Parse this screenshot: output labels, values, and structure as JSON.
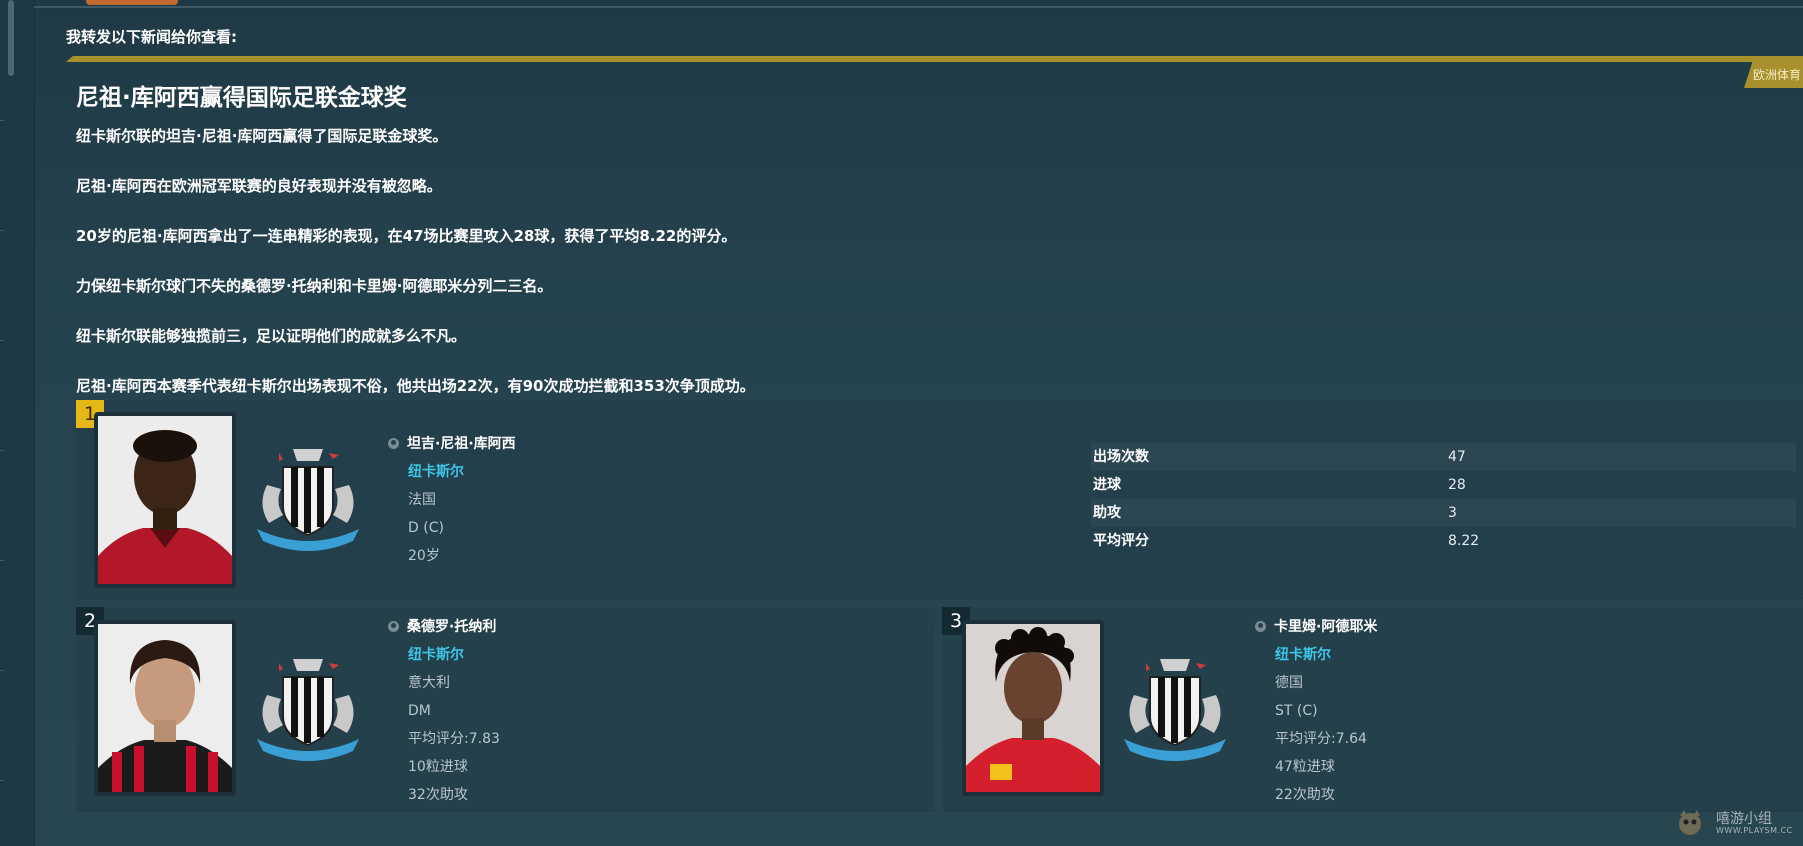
{
  "intro_text": "我转发以下新闻给你查看:",
  "source_badge": "欧洲体育",
  "news": {
    "title": "尼祖·库阿西赢得国际足联金球奖",
    "paragraphs": [
      "纽卡斯尔联的坦吉·尼祖·库阿西赢得了国际足联金球奖。",
      "尼祖·库阿西在欧洲冠军联赛的良好表现并没有被忽略。",
      "20岁的尼祖·库阿西拿出了一连串精彩的表现，在47场比赛里攻入28球，获得了平均8.22的评分。",
      "力保纽卡斯尔球门不失的桑德罗·托纳利和卡里姆·阿德耶米分列二三名。",
      "纽卡斯尔联能够独揽前三，足以证明他们的成就多么不凡。",
      "尼祖·库阿西本赛季代表纽卡斯尔出场表现不俗，他共出场22次，有90次成功拦截和353次争顶成功。"
    ]
  },
  "winner": {
    "rank": "1",
    "name": "坦吉·尼祖·库阿西",
    "club": "纽卡斯尔",
    "nationality": "法国",
    "position": "D (C)",
    "age": "20岁",
    "stats": [
      {
        "label": "出场次数",
        "value": "47"
      },
      {
        "label": "进球",
        "value": "28"
      },
      {
        "label": "助攻",
        "value": "3"
      },
      {
        "label": "平均评分",
        "value": "8.22"
      }
    ]
  },
  "runners_up": [
    {
      "rank": "2",
      "name": "桑德罗·托纳利",
      "club": "纽卡斯尔",
      "nationality": "意大利",
      "position": "DM",
      "rating": "平均评分:7.83",
      "goals": "10粒进球",
      "assists": "32次助攻"
    },
    {
      "rank": "3",
      "name": "卡里姆·阿德耶米",
      "club": "纽卡斯尔",
      "nationality": "德国",
      "position": "ST (C)",
      "rating": "平均评分:7.64",
      "goals": "47粒进球",
      "assists": "22次助攻"
    }
  ],
  "watermark": {
    "main": "嘻游小组",
    "sub": "WWW.PLAYSM.CC"
  },
  "colors": {
    "accent_gold": "#a8902c",
    "rank_gold": "#e5b818",
    "club_link": "#3fc5e7",
    "background": "#23414d"
  }
}
